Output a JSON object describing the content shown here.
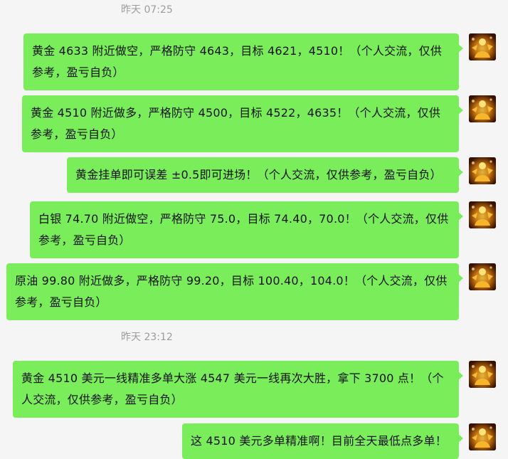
{
  "timestamps": [
    "昨天 07:25",
    "昨天 23:12"
  ],
  "messages": [
    {
      "text": "黄金 4633 附近做空，严格防守 4643，目标 4621，4510！（个人交流，仅供参考，盈亏自负）"
    },
    {
      "text": "黄金 4510 附近做多，严格防守 4500，目标 4522，4635！（个人交流，仅供参考，盈亏自负）"
    },
    {
      "text": "黄金挂单即可误差 ±0.5即可进场！（个人交流，仅供参考，盈亏自负）"
    },
    {
      "text": "白银 74.70 附近做空，严格防守 75.0，目标 74.40，70.0！（个人交流，仅供参考，盈亏自负）"
    },
    {
      "text": "原油 99.80 附近做多，严格防守 99.20，目标 100.40，104.0！（个人交流，仅供参考，盈亏自负）"
    },
    {
      "text": "黄金 4510 美元一线精准多单大涨 4547 美元一线再次大胜，拿下 3700 点！（个人交流，仅供参考，盈亏自负）"
    },
    {
      "text": "这 4510 美元多单精准啊！目前全天最低点多单！"
    }
  ],
  "colors": {
    "background": "#f5f5f5",
    "bubble": "#79ed5a",
    "timestamp_text": "#9c9c9c"
  },
  "avatar_icon": "golden-figure-avatar-icon"
}
